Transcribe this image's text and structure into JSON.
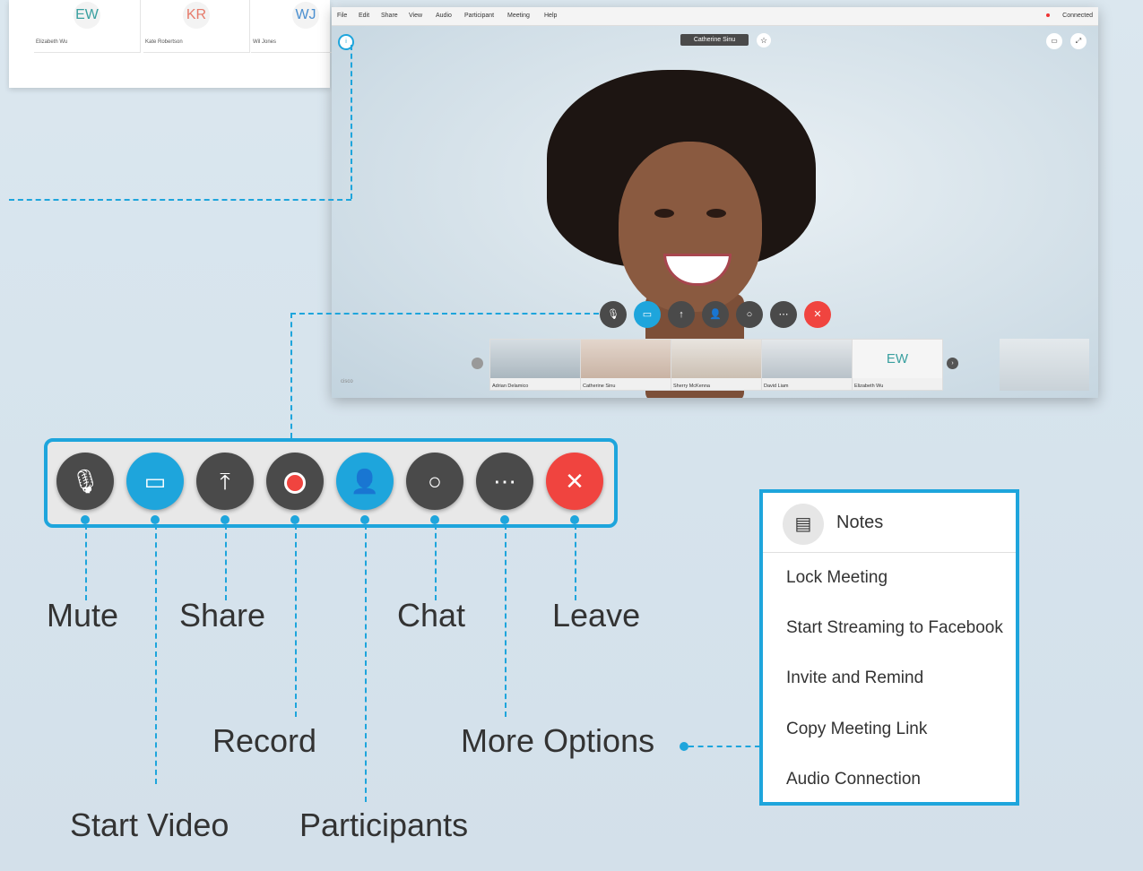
{
  "participants_panel": [
    {
      "initials": "EW",
      "name": "Elizabeth Wu",
      "color": "#3aa0a0"
    },
    {
      "initials": "KR",
      "name": "Kate Robertson",
      "color": "#e67a6a"
    },
    {
      "initials": "WJ",
      "name": "Wil Jones",
      "color": "#4a8fd0"
    }
  ],
  "menubar": {
    "items": [
      "File",
      "Edit",
      "Share",
      "View",
      "Audio",
      "Participant",
      "Meeting",
      "Help"
    ],
    "status": "Connected"
  },
  "active_speaker": "Catherine Sinu",
  "filmstrip": [
    {
      "name": "Adrian Delamico",
      "type": "photo"
    },
    {
      "name": "Catherine Sinu",
      "type": "photo"
    },
    {
      "name": "Sherry McKenna",
      "type": "photo"
    },
    {
      "name": "David Liam",
      "type": "photo"
    },
    {
      "name": "Elizabeth Wu",
      "type": "initials",
      "initials": "EW"
    }
  ],
  "brand": "cisco",
  "toolbar_labels": {
    "mute": "Mute",
    "start_video": "Start Video",
    "share": "Share",
    "record": "Record",
    "participants": "Participants",
    "chat": "Chat",
    "more_options": "More Options",
    "leave": "Leave"
  },
  "more_menu": {
    "notes": "Notes",
    "items": [
      "Lock Meeting",
      "Start Streaming to Facebook",
      "Invite and Remind",
      "Copy Meeting Link",
      "Audio Connection"
    ]
  },
  "colors": {
    "accent": "#1ea5dc",
    "leave": "#f0443f",
    "button": "#4a4a4a"
  }
}
